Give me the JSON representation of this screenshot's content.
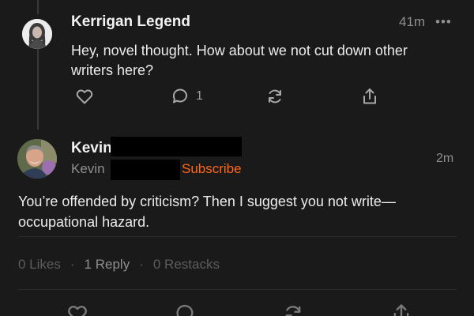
{
  "reply": {
    "author": "Kerrigan Legend",
    "time": "41m",
    "body": "Hey, novel thought. How about we not cut down other writers here?",
    "comment_count": "1",
    "more_icon": "more-horizontal-icon"
  },
  "comment": {
    "author_first": "Kevin",
    "handle_first": "Kevin",
    "subscribe_label": "Subscribe",
    "time": "2m",
    "body": "You’re offended by criticism? Then I suggest you not write—occupational hazard.",
    "likes": "0 Likes",
    "replies": "1 Reply",
    "restacks": "0 Restacks"
  },
  "colors": {
    "background": "#1a1a1a",
    "accent": "#ff6719",
    "text": "#ececec",
    "muted": "#8f8f8f"
  },
  "icons": [
    "heart-icon",
    "comment-icon",
    "restack-icon",
    "share-icon",
    "more-horizontal-icon"
  ]
}
